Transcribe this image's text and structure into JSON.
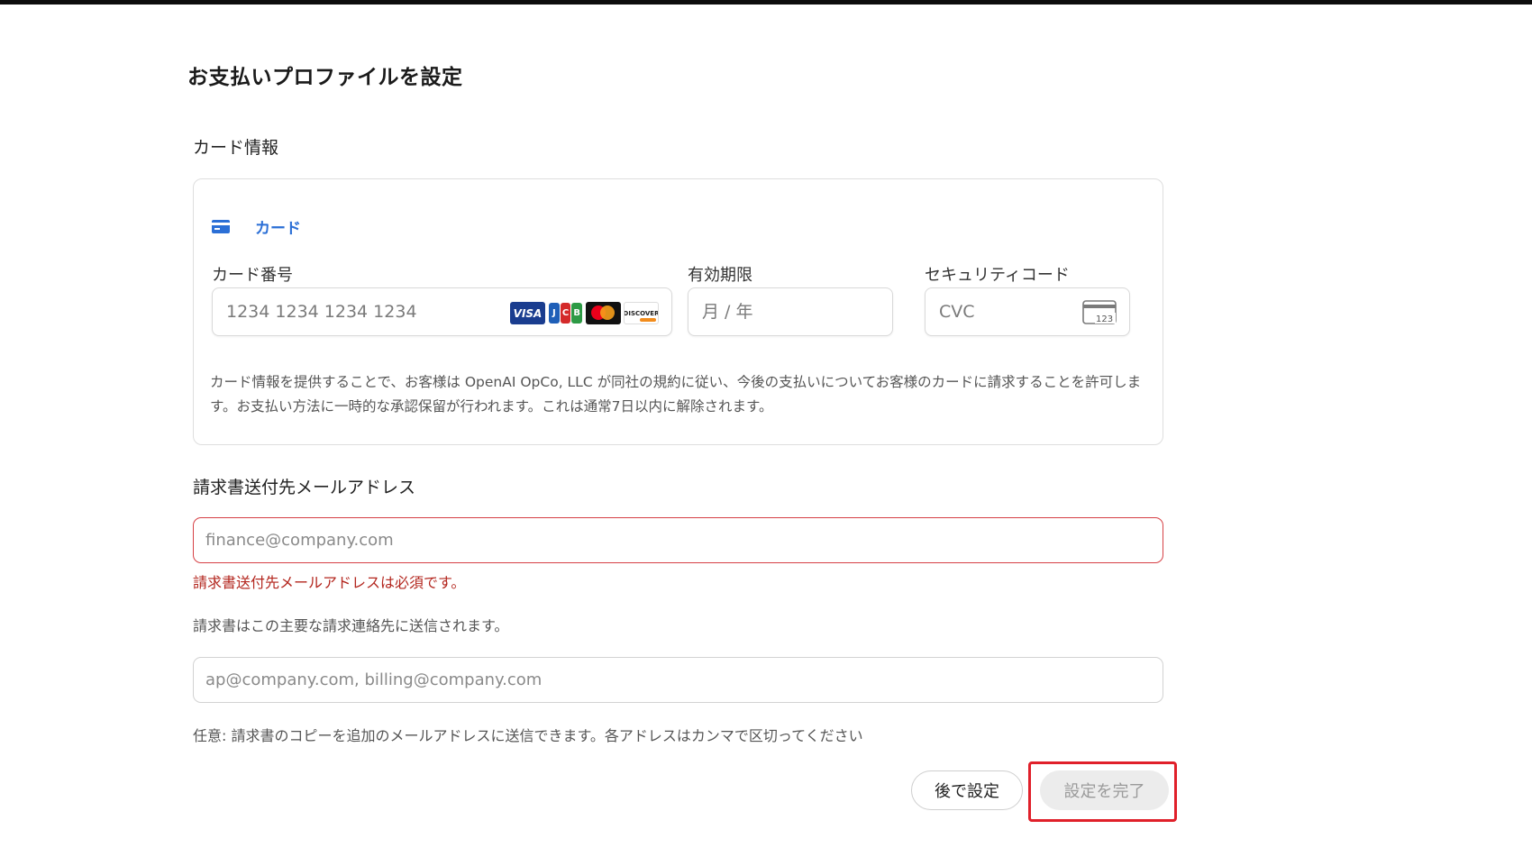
{
  "page": {
    "title": "お支払いプロファイルを設定"
  },
  "card_section": {
    "heading": "カード情報",
    "tab_label": "カード",
    "card_number": {
      "label": "カード番号",
      "placeholder": "1234 1234 1234 1234",
      "brands": [
        "VISA",
        "JCB",
        "Mastercard",
        "DISCOVER"
      ]
    },
    "expiry": {
      "label": "有効期限",
      "placeholder": "月 / 年"
    },
    "cvc": {
      "label": "セキュリティコード",
      "placeholder": "CVC",
      "icon_text": "123"
    },
    "disclaimer": "カード情報を提供することで、お客様は OpenAI OpCo, LLC が同社の規約に従い、今後の支払いについてお客様のカードに請求することを許可します。お支払い方法に一時的な承認保留が行われます。これは通常7日以内に解除されます。"
  },
  "billing_email": {
    "heading": "請求書送付先メールアドレス",
    "placeholder": "finance@company.com",
    "value": "",
    "error": "請求書送付先メールアドレスは必須です。",
    "help": "請求書はこの主要な請求連絡先に送信されます。"
  },
  "cc_emails": {
    "placeholder": "ap@company.com, billing@company.com",
    "value": "",
    "help": "任意: 請求書のコピーを追加のメールアドレスに送信できます。各アドレスはカンマで区切ってください"
  },
  "actions": {
    "later_label": "後で設定",
    "finish_label": "設定を完了"
  },
  "colors": {
    "accent": "#2b6fd6",
    "error": "#b3261e",
    "highlight": "#e0202a"
  }
}
